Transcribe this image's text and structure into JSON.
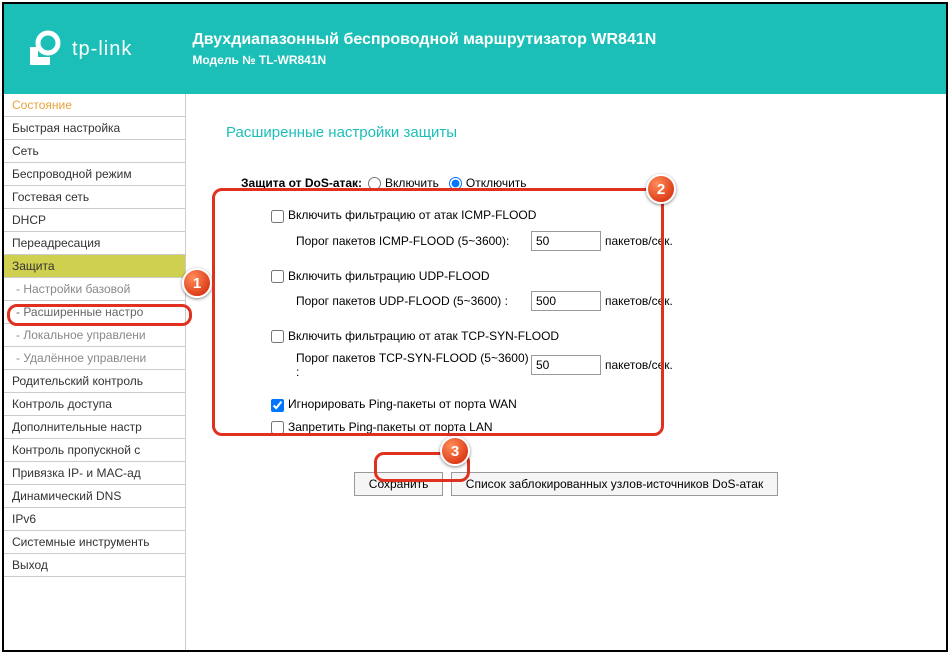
{
  "header": {
    "brand": "tp-link",
    "title": "Двухдиапазонный беспроводной маршрутизатор WR841N",
    "model": "Модель № TL-WR841N"
  },
  "sidebar": {
    "items": [
      {
        "label": "Состояние",
        "cls": "active"
      },
      {
        "label": "Быстрая настройка",
        "cls": ""
      },
      {
        "label": "Сеть",
        "cls": ""
      },
      {
        "label": "Беспроводной режим",
        "cls": ""
      },
      {
        "label": "Гостевая сеть",
        "cls": ""
      },
      {
        "label": "DHCP",
        "cls": ""
      },
      {
        "label": "Переадресация",
        "cls": ""
      },
      {
        "label": "Защита",
        "cls": "selected"
      },
      {
        "label": " - Настройки базовой",
        "cls": "sub"
      },
      {
        "label": " - Расширенные настро",
        "cls": "sub-active"
      },
      {
        "label": " - Локальное управлени",
        "cls": "sub"
      },
      {
        "label": " - Удалённое управлени",
        "cls": "sub"
      },
      {
        "label": "Родительский контроль",
        "cls": ""
      },
      {
        "label": "Контроль доступа",
        "cls": ""
      },
      {
        "label": "Дополнительные настр",
        "cls": ""
      },
      {
        "label": "Контроль пропускной с",
        "cls": ""
      },
      {
        "label": "Привязка IP- и MAC-ад",
        "cls": ""
      },
      {
        "label": "Динамический DNS",
        "cls": ""
      },
      {
        "label": "IPv6",
        "cls": ""
      },
      {
        "label": "Системные инструменть",
        "cls": ""
      },
      {
        "label": "Выход",
        "cls": ""
      }
    ]
  },
  "page": {
    "title": "Расширенные настройки защиты",
    "dos_label": "Защита от DoS-атак:",
    "enable": "Включить",
    "disable": "Отключить",
    "icmp_check": "Включить фильтрацию от атак ICMP-FLOOD",
    "icmp_thresh": "Порог пакетов ICMP-FLOOD (5~3600):",
    "icmp_val": "50",
    "udp_check": "Включить фильтрацию UDP-FLOOD",
    "udp_thresh": "Порог пакетов UDP-FLOOD (5~3600) :",
    "udp_val": "500",
    "tcp_check": "Включить фильтрацию от атак TCP-SYN-FLOOD",
    "tcp_thresh": "Порог пакетов TCP-SYN-FLOOD (5~3600) :",
    "tcp_val": "50",
    "unit": "пакетов/сек.",
    "wan_ping": "Игнорировать Ping-пакеты от порта WAN",
    "lan_ping": "Запретить Ping-пакеты от порта LAN",
    "save": "Сохранить",
    "blocked_list": "Список заблокированных узлов-источников DoS-атак"
  }
}
